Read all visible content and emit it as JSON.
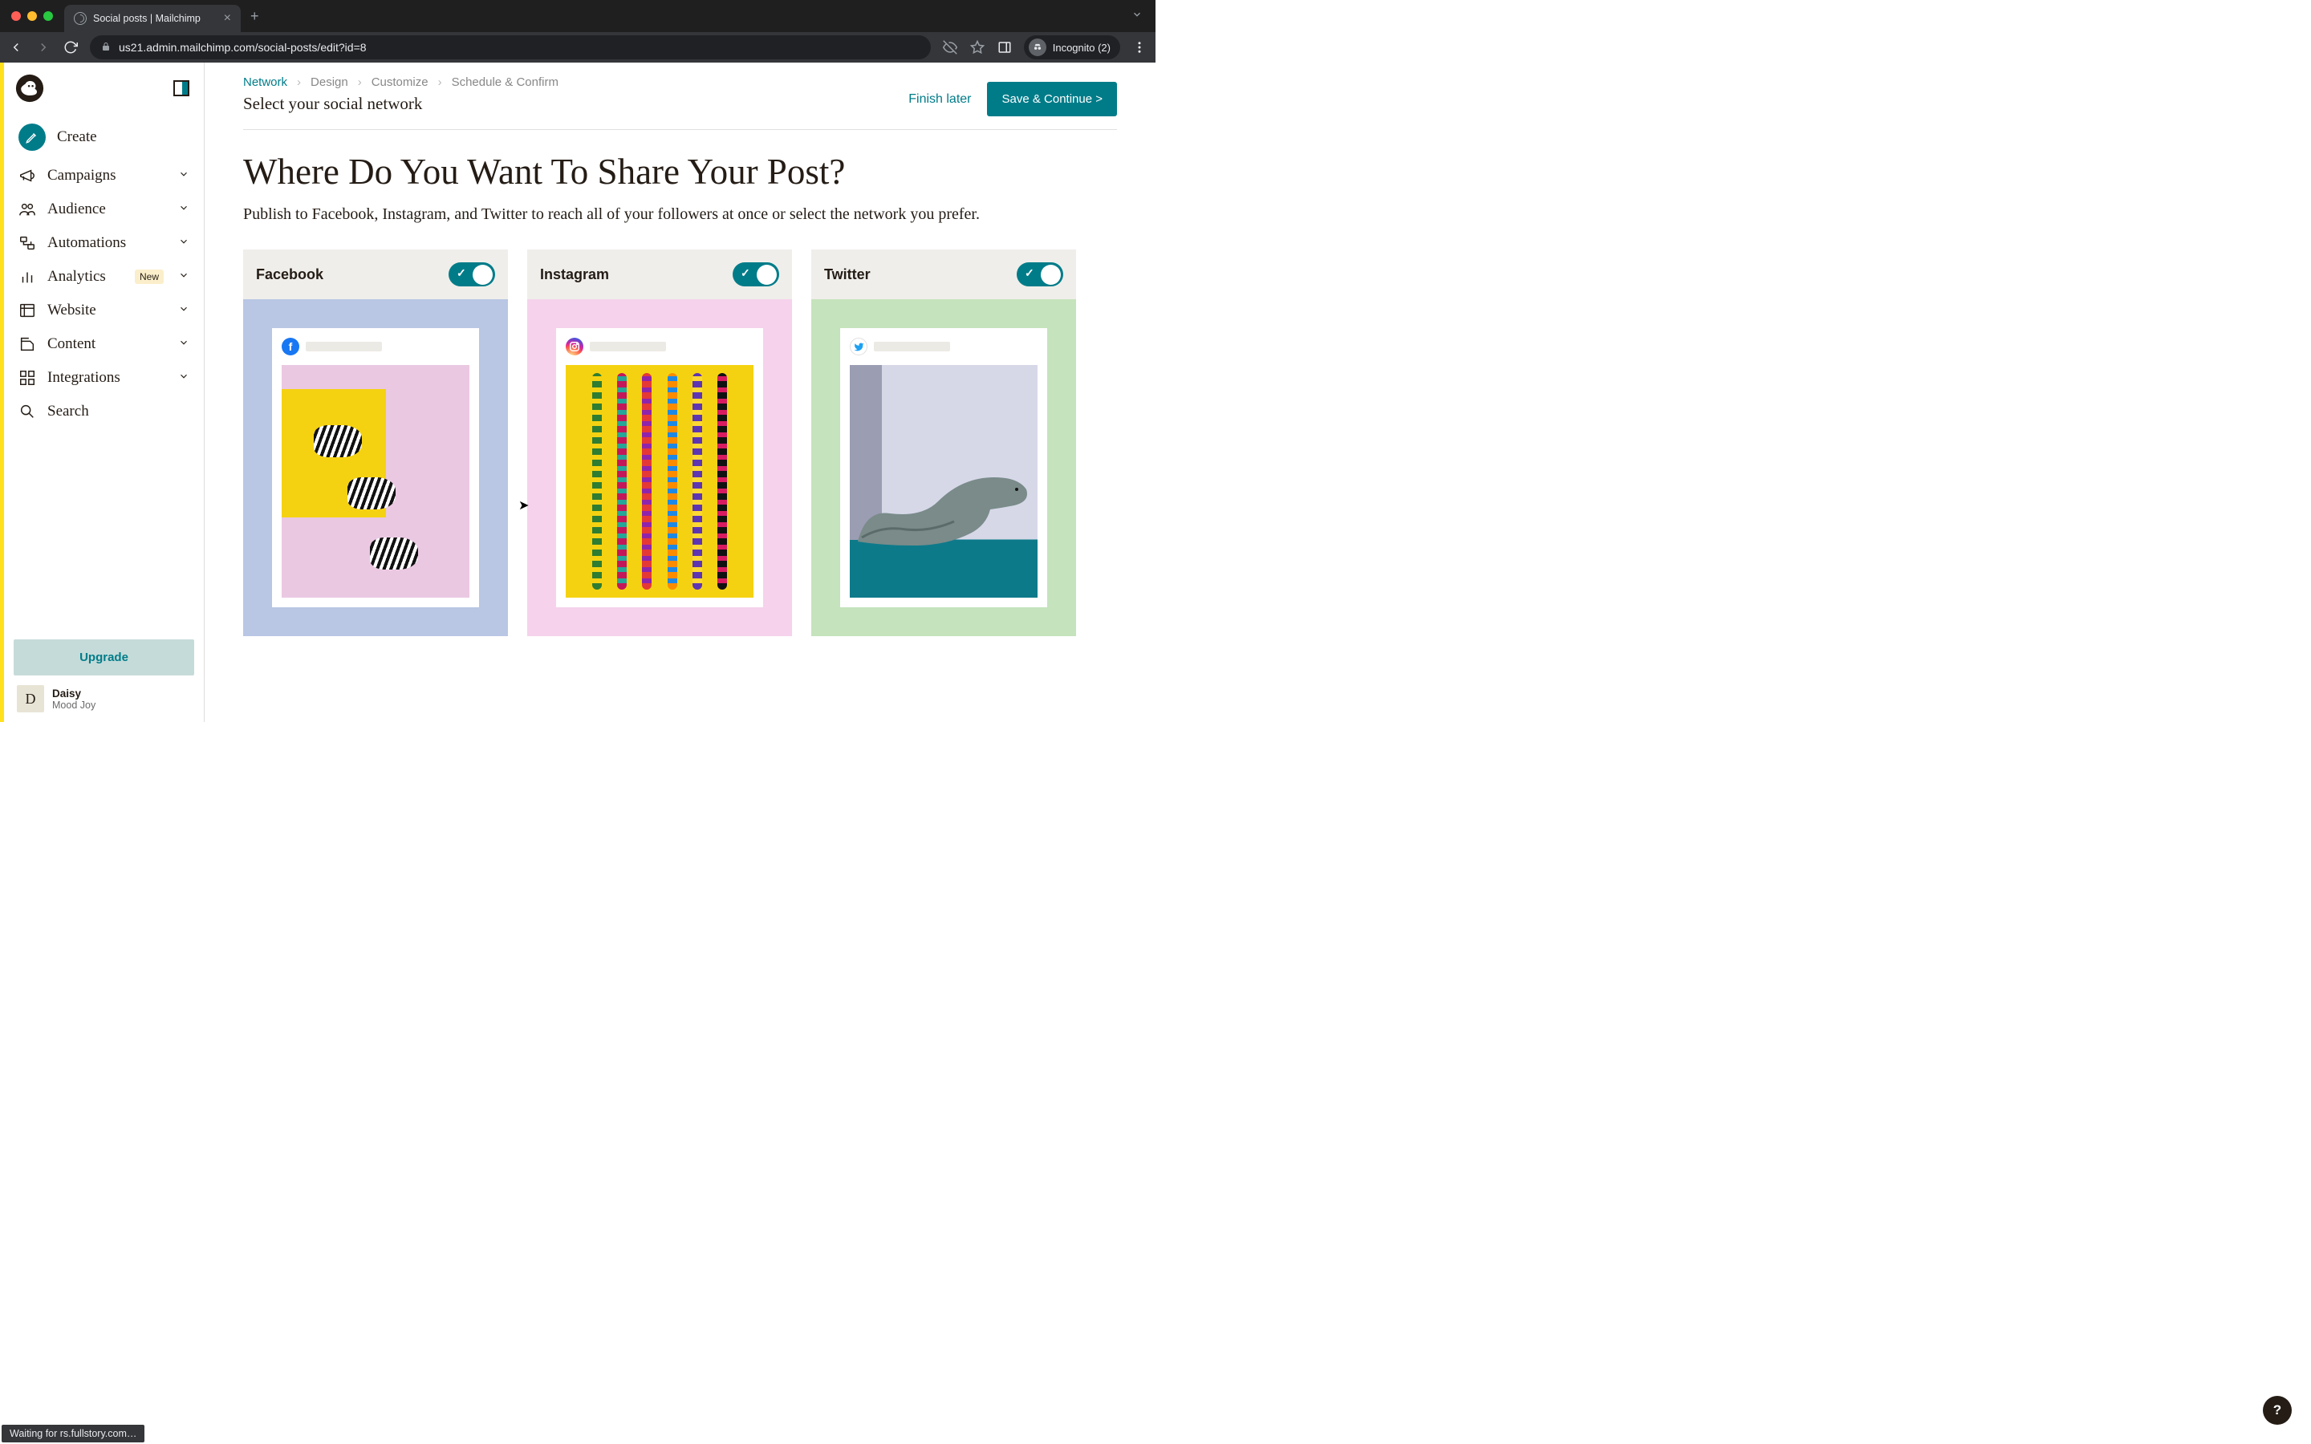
{
  "browser": {
    "tab_title": "Social posts | Mailchimp",
    "url": "us21.admin.mailchimp.com/social-posts/edit?id=8",
    "incognito_label": "Incognito (2)"
  },
  "sidebar": {
    "items": [
      {
        "label": "Create"
      },
      {
        "label": "Campaigns"
      },
      {
        "label": "Audience"
      },
      {
        "label": "Automations"
      },
      {
        "label": "Analytics",
        "badge": "New"
      },
      {
        "label": "Website"
      },
      {
        "label": "Content"
      },
      {
        "label": "Integrations"
      },
      {
        "label": "Search"
      }
    ],
    "upgrade_label": "Upgrade",
    "user": {
      "initial": "D",
      "name": "Daisy",
      "subtitle": "Mood Joy"
    }
  },
  "breadcrumbs": {
    "items": [
      "Network",
      "Design",
      "Customize",
      "Schedule & Confirm"
    ],
    "subtitle": "Select your social network"
  },
  "header": {
    "finish_later": "Finish later",
    "save_continue": "Save & Continue >"
  },
  "page": {
    "title": "Where Do You Want To Share Your Post?",
    "description": "Publish to Facebook, Instagram, and Twitter to reach all of your followers at once or select the network you prefer."
  },
  "networks": [
    {
      "name": "Facebook",
      "enabled": true,
      "icon": "facebook",
      "bg": "#b9c6e4"
    },
    {
      "name": "Instagram",
      "enabled": true,
      "icon": "instagram",
      "bg": "#f6d2ec"
    },
    {
      "name": "Twitter",
      "enabled": true,
      "icon": "twitter",
      "bg": "#c5e3bc"
    }
  ],
  "status_bar": "Waiting for rs.fullstory.com…",
  "colors": {
    "accent": "#007c89",
    "brand_yellow": "#ffe01b"
  }
}
